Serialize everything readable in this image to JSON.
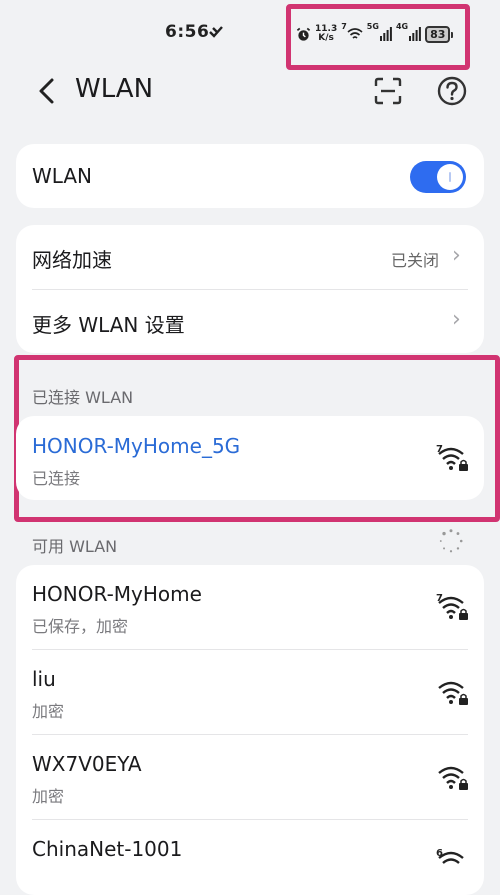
{
  "status_bar": {
    "time": "6:56",
    "speed_value": "11.3",
    "speed_unit": "K/s",
    "wifi_badge": "7",
    "net1": "5G",
    "net2": "4G",
    "battery": "83"
  },
  "header": {
    "title": "WLAN",
    "back_icon": "chevron-left-icon",
    "scan_icon": "scan-icon",
    "help_icon": "question-circle-icon"
  },
  "wlan_toggle": {
    "label": "WLAN",
    "on": true
  },
  "settings": [
    {
      "label": "网络加速",
      "value": "已关闭"
    },
    {
      "label": "更多 WLAN 设置",
      "value": ""
    }
  ],
  "connected": {
    "section_label": "已连接 WLAN",
    "name": "HONOR-MyHome_5G",
    "status": "已连接",
    "badge": "7"
  },
  "available": {
    "section_label": "可用 WLAN",
    "networks": [
      {
        "name": "HONOR-MyHome",
        "status": "已保存，加密",
        "badge": "7"
      },
      {
        "name": "liu",
        "status": "加密",
        "badge": ""
      },
      {
        "name": "WX7V0EYA",
        "status": "加密",
        "badge": ""
      },
      {
        "name": "ChinaNet-1001",
        "status": "",
        "badge": "6"
      }
    ]
  },
  "colors": {
    "accent": "#2e6cf0",
    "link": "#2a6bd6",
    "highlight": "#d13471",
    "background": "#f1f2f4"
  }
}
